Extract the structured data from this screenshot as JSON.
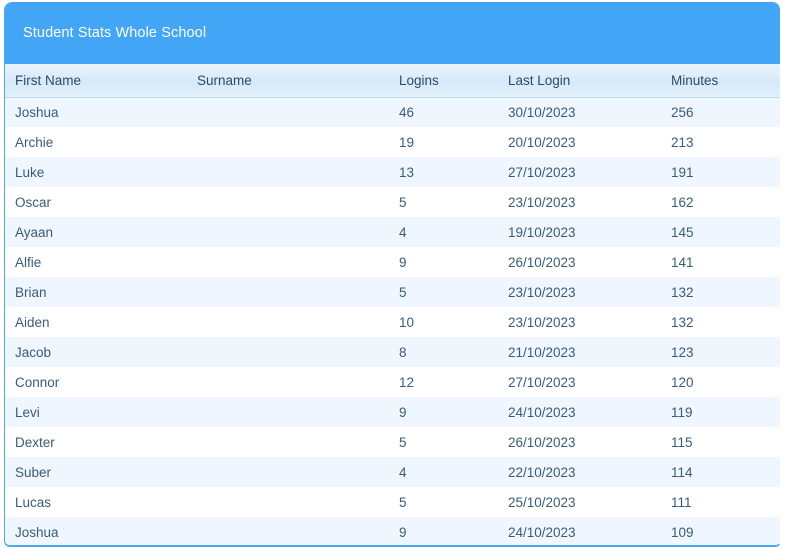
{
  "panel": {
    "title": "Student Stats Whole School",
    "accent_color": "#42a5f5",
    "header_row_color": "#dceafa",
    "row_stripe_color": "#eff6fd",
    "text_color": "#3a5c78"
  },
  "table": {
    "columns": [
      {
        "key": "first_name",
        "label": "First Name"
      },
      {
        "key": "surname",
        "label": "Surname"
      },
      {
        "key": "logins",
        "label": "Logins"
      },
      {
        "key": "last_login",
        "label": "Last Login"
      },
      {
        "key": "minutes",
        "label": "Minutes"
      }
    ],
    "sorted_by": "Minutes",
    "sort_direction": "descending",
    "sort_icon": "triangle-down-icon",
    "rows": [
      {
        "first_name": "Joshua",
        "surname": "",
        "logins": "46",
        "last_login": "30/10/2023",
        "minutes": "256"
      },
      {
        "first_name": "Archie",
        "surname": "",
        "logins": "19",
        "last_login": "20/10/2023",
        "minutes": "213"
      },
      {
        "first_name": "Luke",
        "surname": "",
        "logins": "13",
        "last_login": "27/10/2023",
        "minutes": "191"
      },
      {
        "first_name": "Oscar",
        "surname": "",
        "logins": "5",
        "last_login": "23/10/2023",
        "minutes": "162"
      },
      {
        "first_name": "Ayaan",
        "surname": "",
        "logins": "4",
        "last_login": "19/10/2023",
        "minutes": "145"
      },
      {
        "first_name": "Alfie",
        "surname": "",
        "logins": "9",
        "last_login": "26/10/2023",
        "minutes": "141"
      },
      {
        "first_name": "Brian",
        "surname": "",
        "logins": "5",
        "last_login": "23/10/2023",
        "minutes": "132"
      },
      {
        "first_name": "Aiden",
        "surname": "",
        "logins": "10",
        "last_login": "23/10/2023",
        "minutes": "132"
      },
      {
        "first_name": "Jacob",
        "surname": "",
        "logins": "8",
        "last_login": "21/10/2023",
        "minutes": "123"
      },
      {
        "first_name": "Connor",
        "surname": "",
        "logins": "12",
        "last_login": "27/10/2023",
        "minutes": "120"
      },
      {
        "first_name": "Levi",
        "surname": "",
        "logins": "9",
        "last_login": "24/10/2023",
        "minutes": "119"
      },
      {
        "first_name": "Dexter",
        "surname": "",
        "logins": "5",
        "last_login": "26/10/2023",
        "minutes": "115"
      },
      {
        "first_name": "Suber",
        "surname": "",
        "logins": "4",
        "last_login": "22/10/2023",
        "minutes": "114"
      },
      {
        "first_name": "Lucas",
        "surname": "",
        "logins": "5",
        "last_login": "25/10/2023",
        "minutes": "111"
      },
      {
        "first_name": "Joshua",
        "surname": "",
        "logins": "9",
        "last_login": "24/10/2023",
        "minutes": "109"
      }
    ]
  }
}
